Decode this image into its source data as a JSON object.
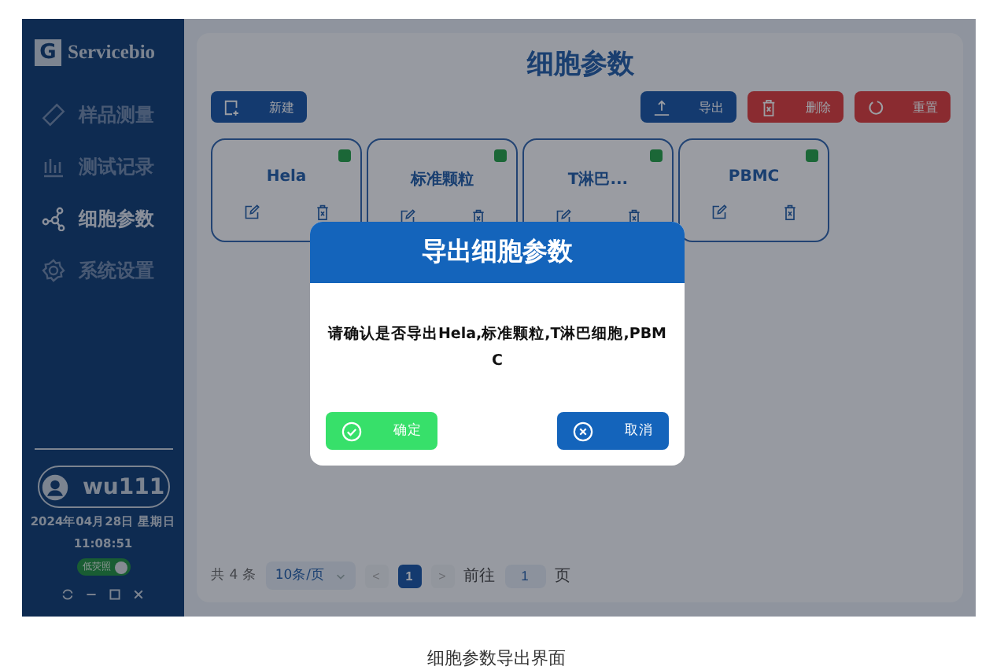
{
  "sidebar": {
    "logo_letter": "G",
    "logo_text": "Servicebio",
    "items": [
      {
        "label": "样品测量",
        "selected": false
      },
      {
        "label": "测试记录",
        "selected": false
      },
      {
        "label": "细胞参数",
        "selected": true
      },
      {
        "label": "系统设置",
        "selected": false
      }
    ],
    "user": "wu111",
    "date": "2024年04月28日 星期日",
    "time": "11:08:51",
    "toggle": {
      "label": "低荧照",
      "on": true
    }
  },
  "main": {
    "title": "细胞参数",
    "toolbar": [
      {
        "label": "新建",
        "kind": "primary"
      },
      {
        "label": "导出",
        "kind": "primary"
      },
      {
        "label": "删除",
        "kind": "danger"
      },
      {
        "label": "重置",
        "kind": "danger"
      }
    ],
    "cards": [
      {
        "name": "Hela"
      },
      {
        "name": "标准颗粒"
      },
      {
        "name": "T淋巴..."
      },
      {
        "name": "PBMC"
      }
    ],
    "pagination": {
      "total": "共 4 条",
      "page_size": "10条/页",
      "prev": "<",
      "pages": [
        {
          "label": "1",
          "selected": true
        }
      ],
      "next": ">",
      "goto": "前往",
      "goto_value": "1",
      "unit": "页"
    }
  },
  "dialog": {
    "title": "导出细胞参数",
    "message": "请确认是否导出Hela,标准颗粒,T淋巴细胞,PBMC",
    "confirm": "确定",
    "cancel": "取消"
  },
  "caption": "细胞参数导出界面"
}
